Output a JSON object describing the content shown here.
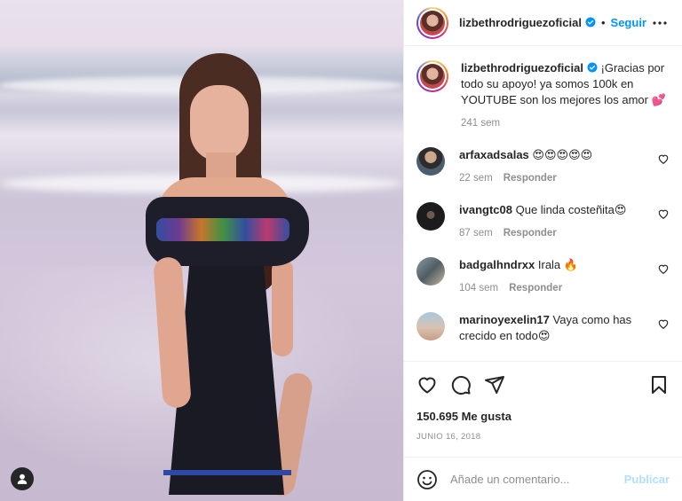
{
  "post": {
    "username": "lizbethrodriguezoficial",
    "follow_label": "Seguir",
    "dot": "•"
  },
  "caption": {
    "username": "lizbethrodriguezoficial",
    "text": "¡Gracias por todo su apoyo! ya somos 100k en YOUTUBE son los mejores los amor 💕",
    "time": "241 sem"
  },
  "comments": [
    {
      "username": "arfaxadsalas",
      "text": "😍😍😍😍😍",
      "time": "22 sem",
      "reply": "Responder"
    },
    {
      "username": "ivangtc08",
      "text": "Que linda costeñita😍",
      "time": "87 sem",
      "reply": "Responder"
    },
    {
      "username": "badgalhndrxx",
      "text": "Irala 🔥",
      "time": "104 sem",
      "reply": "Responder"
    },
    {
      "username": "marinoyexelin17",
      "text": "Vaya como has crecido en todo😍",
      "time": "",
      "reply": ""
    }
  ],
  "stats": {
    "likes": "150.695 Me gusta",
    "date": "JUNIO 16, 2018"
  },
  "composer": {
    "placeholder": "Añade un comentario...",
    "post_label": "Publicar"
  },
  "colors": {
    "accent": "#0095f6",
    "publish_disabled": "#b2dffc",
    "muted": "#8e8e8e"
  },
  "icons": [
    "more-options-icon",
    "verified-badge-icon",
    "like-icon",
    "comment-icon",
    "share-icon",
    "save-icon",
    "emoji-icon",
    "user-tag-icon",
    "heart-small-icon"
  ]
}
